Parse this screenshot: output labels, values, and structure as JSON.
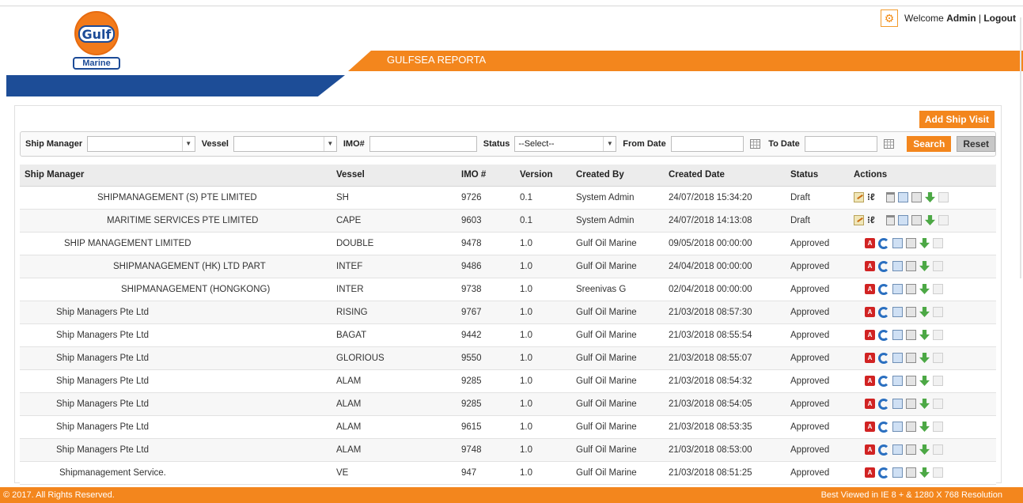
{
  "header": {
    "logo_top": "Gulf",
    "logo_bottom": "Marine",
    "app_title": "GULFSEA REPORTA",
    "welcome_prefix": "Welcome",
    "user": "Admin",
    "separator": "|",
    "logout": "Logout"
  },
  "toolbar": {
    "add_label": "Add Ship Visit"
  },
  "filters": {
    "ship_manager_label": "Ship Manager",
    "ship_manager_value": "",
    "vessel_label": "Vessel",
    "vessel_value": "",
    "imo_label": "IMO#",
    "imo_value": "",
    "status_label": "Status",
    "status_value": "--Select--",
    "from_label": "From Date",
    "from_value": "",
    "to_label": "To Date",
    "to_value": "",
    "search_label": "Search",
    "reset_label": "Reset"
  },
  "table": {
    "headers": [
      "Ship Manager",
      "Vessel",
      "IMO #",
      "Version",
      "Created By",
      "Created Date",
      "Status",
      "Actions"
    ],
    "rows": [
      {
        "manager": "SHIPMANAGEMENT (S) PTE LIMITED",
        "vessel": "SH",
        "imo": "9726",
        "version": "0.1",
        "created_by": "System Admin",
        "created_date": "24/07/2018 15:34:20",
        "status": "Draft"
      },
      {
        "manager": "MARITIME SERVICES PTE LIMITED",
        "vessel": "CAPE",
        "imo": "9603",
        "version": "0.1",
        "created_by": "System Admin",
        "created_date": "24/07/2018 14:13:08",
        "status": "Draft"
      },
      {
        "manager": "SHIP MANAGEMENT LIMITED",
        "vessel": "DOUBLE",
        "imo": "9478",
        "version": "1.0",
        "created_by": "Gulf Oil Marine",
        "created_date": "09/05/2018 00:00:00",
        "status": "Approved"
      },
      {
        "manager": "SHIPMANAGEMENT (HK) LTD PART",
        "vessel": "INTEF",
        "imo": "9486",
        "version": "1.0",
        "created_by": "Gulf Oil Marine",
        "created_date": "24/04/2018 00:00:00",
        "status": "Approved"
      },
      {
        "manager": "SHIPMANAGEMENT (HONGKONG)",
        "vessel": "INTER",
        "imo": "9738",
        "version": "1.0",
        "created_by": "Sreenivas G",
        "created_date": "02/04/2018 00:00:00",
        "status": "Approved"
      },
      {
        "manager": "Ship Managers Pte Ltd",
        "vessel": "RISING",
        "imo": "9767",
        "version": "1.0",
        "created_by": "Gulf Oil Marine",
        "created_date": "21/03/2018 08:57:30",
        "status": "Approved"
      },
      {
        "manager": "Ship Managers Pte Ltd",
        "vessel": "BAGAT",
        "imo": "9442",
        "version": "1.0",
        "created_by": "Gulf Oil Marine",
        "created_date": "21/03/2018 08:55:54",
        "status": "Approved"
      },
      {
        "manager": "Ship Managers Pte Ltd",
        "vessel": "GLORIOUS",
        "imo": "9550",
        "version": "1.0",
        "created_by": "Gulf Oil Marine",
        "created_date": "21/03/2018 08:55:07",
        "status": "Approved"
      },
      {
        "manager": "Ship Managers Pte Ltd",
        "vessel": "ALAM",
        "imo": "9285",
        "version": "1.0",
        "created_by": "Gulf Oil Marine",
        "created_date": "21/03/2018 08:54:32",
        "status": "Approved"
      },
      {
        "manager": "Ship Managers Pte Ltd",
        "vessel": "ALAM",
        "imo": "9285",
        "version": "1.0",
        "created_by": "Gulf Oil Marine",
        "created_date": "21/03/2018 08:54:05",
        "status": "Approved"
      },
      {
        "manager": "Ship Managers Pte Ltd",
        "vessel": "ALAM",
        "imo": "9615",
        "version": "1.0",
        "created_by": "Gulf Oil Marine",
        "created_date": "21/03/2018 08:53:35",
        "status": "Approved"
      },
      {
        "manager": "Ship Managers Pte Ltd",
        "vessel": "ALAM",
        "imo": "9748",
        "version": "1.0",
        "created_by": "Gulf Oil Marine",
        "created_date": "21/03/2018 08:53:00",
        "status": "Approved"
      },
      {
        "manager": "Shipmanagement Service.",
        "vessel": "VE",
        "imo": "947",
        "version": "1.0",
        "created_by": "Gulf Oil Marine",
        "created_date": "21/03/2018 08:51:25",
        "status": "Approved"
      }
    ]
  },
  "footer": {
    "copyright": "© 2017. All Rights Reserved.",
    "best_viewed": "Best Viewed in IE 8 + & 1280 X 768 Resolution"
  },
  "colors": {
    "accent": "#f3861d",
    "brand_blue": "#1d4d97"
  },
  "icons": {
    "draft_actions": [
      "edit-icon",
      "route-icon",
      "trash-icon",
      "copy-icon",
      "document-icon",
      "download-icon",
      "blank-doc-icon"
    ],
    "approved_actions": [
      "pdf-icon",
      "refresh-icon",
      "copy-icon",
      "document-icon",
      "download-icon",
      "blank-doc-icon"
    ]
  }
}
